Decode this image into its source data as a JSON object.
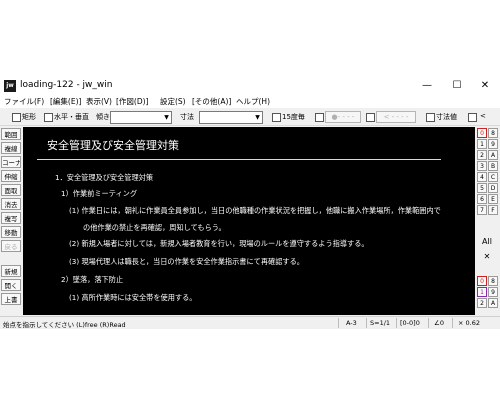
{
  "window": {
    "icon_text": "jw",
    "title": "loading-122 - jw_win",
    "minimize_glyph": "—",
    "maximize_glyph": "☐",
    "close_glyph": "✕"
  },
  "menu": [
    "ファイル(F)",
    "[編集(E)]",
    "表示(V)",
    "[作図(D)]",
    "設定(S)",
    "[その他(A)]",
    "ヘルプ(H)"
  ],
  "toolbar": {
    "rect_label": "矩形",
    "hv_label": "水平・垂直",
    "tilt_label": "傾き",
    "dim_label": "寸法",
    "deg15_label": "15度毎",
    "dot_btn": "●- - - -",
    "arrow_btn": "< - - - -",
    "dimval_label": "寸法値",
    "lt_label": "<"
  },
  "left_tools": [
    "範囲",
    "複線",
    "コーナー",
    "伸縮",
    "面取",
    "消去",
    "複写",
    "移動",
    "戻る",
    "新規",
    "開く",
    "上書"
  ],
  "right_tools": {
    "left_col": [
      "0",
      "1",
      "2",
      "3",
      "4",
      "5",
      "6",
      "7"
    ],
    "right_col": [
      "8",
      "9",
      "A",
      "B",
      "C",
      "D",
      "E",
      "F"
    ],
    "all_label": "All",
    "x_label": "✕",
    "bottom": [
      "0",
      "1",
      "2"
    ],
    "bottom_right": [
      "8",
      "9",
      "A"
    ]
  },
  "document": {
    "title": "安全管理及び安全管理対策",
    "lines": [
      "1．安全管理及び安全管理対策",
      "1）作業前ミーティング",
      "(1) 作業日には，朝礼に作業員全員参加し，当日の他職種の作業状況を把握し，他職に搬入作業場所，作業範囲内で",
      "の他作業の禁止を再確認，周知してもらう。",
      "(2) 新規入場者に対しては，新規入場者教育を行い，現場のルールを遵守するよう指導する。",
      "(3) 現場代理人は職長と，当日の作業を安全作業指示書にて再確認する。",
      "2）墜落，落下防止",
      "(1) 高所作業時には安全帯を使用する。"
    ]
  },
  "status": {
    "prompt": "始点を指示してください (L)free (R)Read",
    "paper": "A-3",
    "scale": "S=1/1",
    "layer": "[0-0]0",
    "angle": "∠0",
    "zoom": "× 0.62"
  }
}
